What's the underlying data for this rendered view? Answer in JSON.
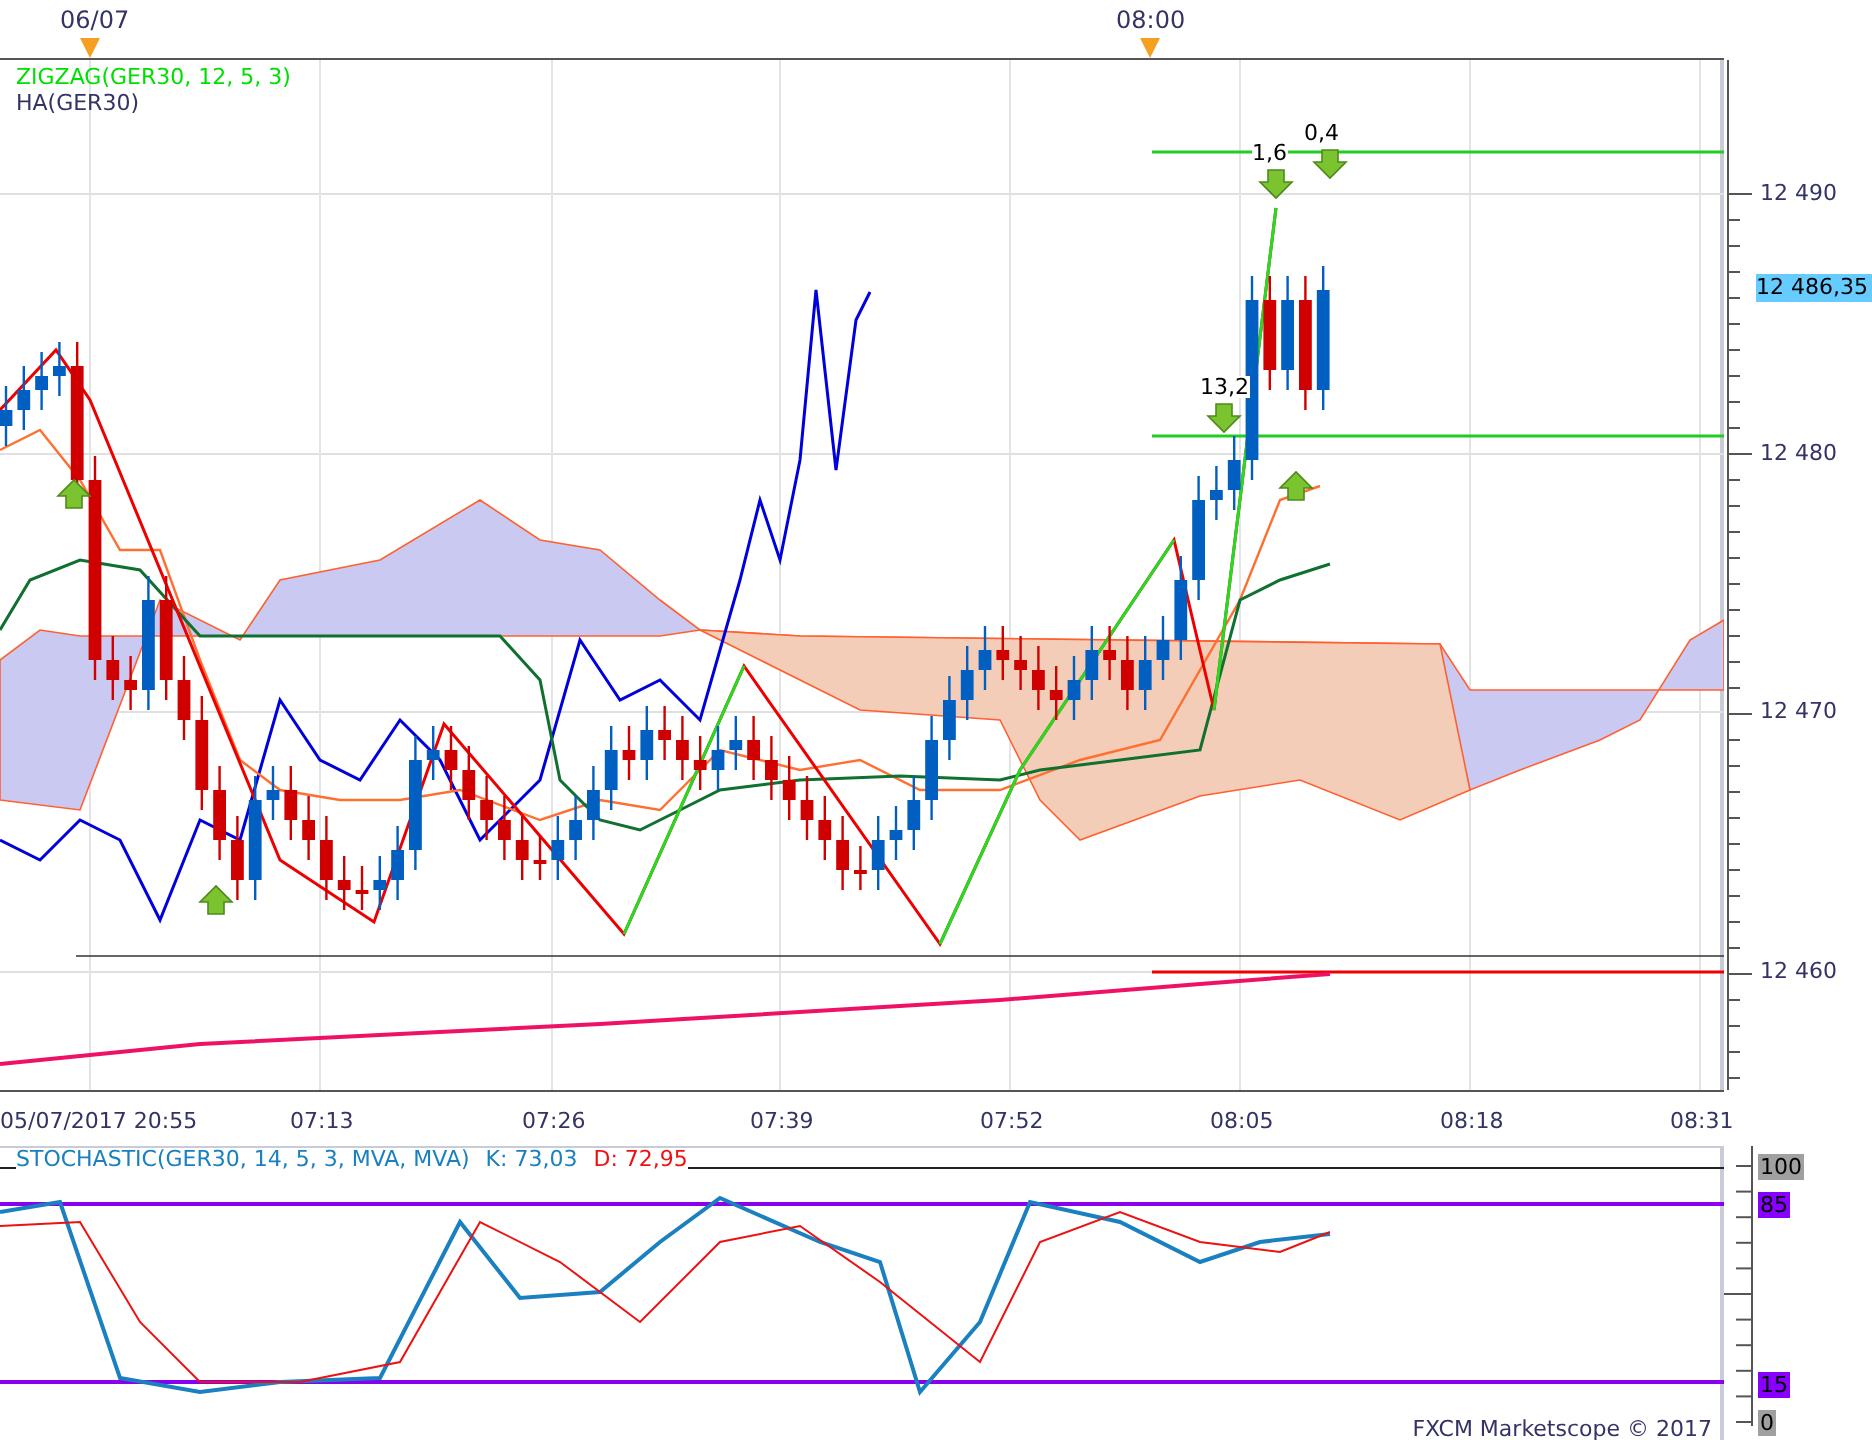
{
  "top_axis": {
    "labels": [
      "06/07",
      "08:00"
    ]
  },
  "legend": [
    {
      "text": "ZIGZAG(GER30, 12, 5, 3)",
      "color": "#00e000"
    },
    {
      "text": "HA(GER30)",
      "color": "#333366"
    }
  ],
  "annotations": [
    "13,2",
    "1,6",
    "0,4"
  ],
  "price_axis": {
    "labels": [
      "12 490",
      "12 480",
      "12 470",
      "12 460"
    ],
    "current_price": "12 486,35"
  },
  "time_axis": {
    "labels": [
      "05/07/2017 20:55",
      "07:13",
      "07:26",
      "07:39",
      "07:52",
      "08:05",
      "08:18",
      "08:31"
    ]
  },
  "stochastic": {
    "title": "STOCHASTIC(GER30, 14, 5, 3, MVA, MVA)",
    "k": "K: 73,03",
    "d": "D: 72,95",
    "levels": [
      {
        "text": "100",
        "kind": "bound"
      },
      {
        "text": "85",
        "kind": "signal"
      },
      {
        "text": "15",
        "kind": "signal"
      },
      {
        "text": "0",
        "kind": "bound"
      }
    ]
  },
  "footer": "FXCM Marketscope © 2017"
}
